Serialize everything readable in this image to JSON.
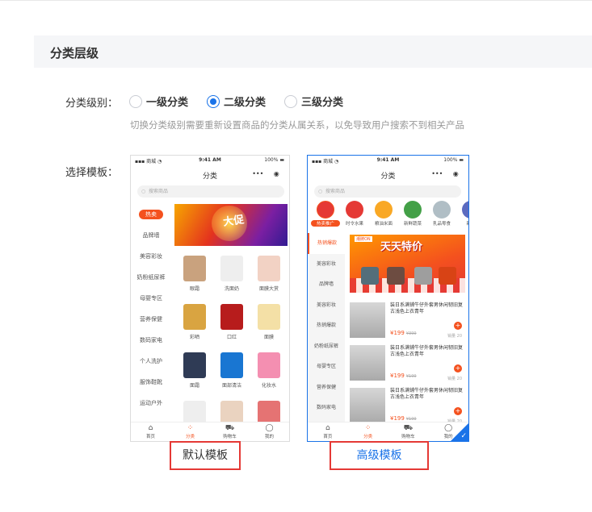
{
  "section": {
    "title": "分类层级"
  },
  "level": {
    "label": "分类级别：",
    "options": [
      {
        "label": "一级分类",
        "checked": false
      },
      {
        "label": "二级分类",
        "checked": true
      },
      {
        "label": "三级分类",
        "checked": false
      }
    ],
    "hint": "切换分类级别需要重新设置商品的分类从属关系，以免导致用户搜索不到相关产品"
  },
  "template": {
    "label": "选择模板：",
    "default_caption": "默认模板",
    "advanced_caption": "高级模板",
    "selected": "advanced"
  },
  "phone": {
    "carrier": "▪▪▪ 商城 ◔",
    "time": "9:41 AM",
    "battery": "100% ▬",
    "title": "分类",
    "capsule_more": "•••",
    "capsule_close": "◉",
    "search_placeholder": "搜索商品",
    "tabs": [
      {
        "label": "首页",
        "icon": "⌂"
      },
      {
        "label": "分类",
        "icon": "⁘"
      },
      {
        "label": "购物车",
        "icon": "⛟"
      },
      {
        "label": "我的",
        "icon": "◯"
      }
    ]
  },
  "default_tpl": {
    "sidebar": [
      "热卖",
      "品牌墙",
      "美容彩妆",
      "奶粉纸尿裤",
      "母婴专区",
      "营养保健",
      "数码家电",
      "个人洗护",
      "服饰鞋靴",
      "运动户外"
    ],
    "grid": [
      {
        "label": "眼霜",
        "color": "#c9a27e"
      },
      {
        "label": "洗面奶",
        "color": "#eeeeee"
      },
      {
        "label": "面膜大赏",
        "color": "#f2d2c4"
      },
      {
        "label": "彩晒",
        "color": "#d9a441"
      },
      {
        "label": "口红",
        "color": "#b71c1c"
      },
      {
        "label": "面膜",
        "color": "#f4e0a6"
      },
      {
        "label": "面霜",
        "color": "#2f3b55"
      },
      {
        "label": "面部清洁",
        "color": "#1976d2"
      },
      {
        "label": "化妆水",
        "color": "#f48fb1"
      },
      {
        "label": "",
        "color": "#eeeeee"
      },
      {
        "label": "",
        "color": "#ead3c0"
      },
      {
        "label": "",
        "color": "#e57373"
      }
    ],
    "banner_text": "大促"
  },
  "advanced_tpl": {
    "cats": [
      {
        "label": "热卖推广",
        "color": "#e53935"
      },
      {
        "label": "时令水果",
        "color": "#e53935"
      },
      {
        "label": "粮油米面",
        "color": "#f9a825"
      },
      {
        "label": "新鲜蔬菜",
        "color": "#43a047"
      },
      {
        "label": "乳品零食",
        "color": "#b0bec5"
      },
      {
        "label": "新品",
        "color": "#5c6bc0"
      }
    ],
    "sidebar": [
      "热销爆款",
      "美容彩妆",
      "品牌墙",
      "美容彩妆",
      "热销爆款",
      "奶粉纸尿裤",
      "母婴专区",
      "营养保健",
      "数码家电"
    ],
    "banner_tag": "潮牌ON",
    "banner_title": "天天特价",
    "products": [
      {
        "title": "装日系满铺牛仔外套男休闲韧旧复古浅色上衣青年",
        "price": "¥199",
        "old": "¥399",
        "sold": "销量 20"
      },
      {
        "title": "装日系满铺牛仔外套男休闲韧旧复古浅色上衣青年",
        "price": "¥199",
        "old": "¥199",
        "sold": "销量 20"
      },
      {
        "title": "装日系满铺牛仔外套男休闲韧旧复古浅色上衣青年",
        "price": "¥199",
        "old": "¥199",
        "sold": "销量 20"
      }
    ]
  }
}
